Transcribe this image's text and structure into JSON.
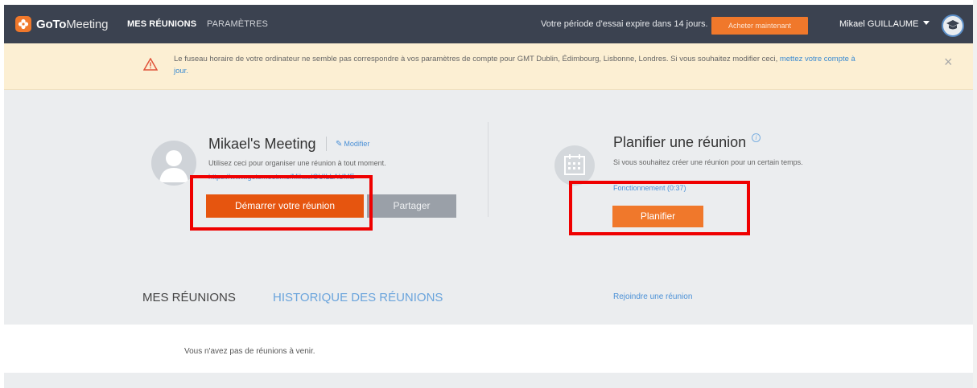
{
  "brand": {
    "name_bold": "GoTo",
    "name_light": "Meeting"
  },
  "nav": {
    "my_meetings": "MES RÉUNIONS",
    "settings": "PARAMÈTRES"
  },
  "trial": {
    "message": "Votre période d'essai expire dans 14 jours.",
    "buy_label": "Acheter maintenant"
  },
  "user": {
    "name": "Mikael GUILLAUME"
  },
  "banner": {
    "text": "Le fuseau horaire de votre ordinateur ne semble pas correspondre à vos paramètres de compte pour GMT Dublin, Édimbourg, Lisbonne, Londres. Si vous souhaitez modifier ceci, ",
    "link": "mettez votre compte à jour.",
    "close": "×"
  },
  "meeting": {
    "title": "Mikael's Meeting",
    "edit_label": "Modifier",
    "description": "Utilisez ceci pour organiser une réunion à tout moment.",
    "url": "https://www.gotomeet.me/MikaelGUILLAUME",
    "start_label": "Démarrer votre réunion",
    "share_label": "Partager"
  },
  "schedule": {
    "title": "Planifier une réunion",
    "info": "i",
    "description": "Si vous souhaitez créer une réunion pour un certain temps.",
    "how_link": "Fonctionnement (0:37)",
    "button_label": "Planifier"
  },
  "tabs": {
    "my_meetings": "MES RÉUNIONS",
    "history": "HISTORIQUE DES RÉUNIONS"
  },
  "join_link": "Rejoindre une réunion",
  "empty_message": "Vous n'avez pas de réunions à venir.",
  "colors": {
    "nav_bg": "#3b4250",
    "accent_orange": "#f0782b",
    "start_orange": "#e6550f",
    "banner_bg": "#fcefd3",
    "hero_bg": "#ebedef",
    "link_blue": "#4a90d6",
    "annotation_red": "#ef0000"
  }
}
